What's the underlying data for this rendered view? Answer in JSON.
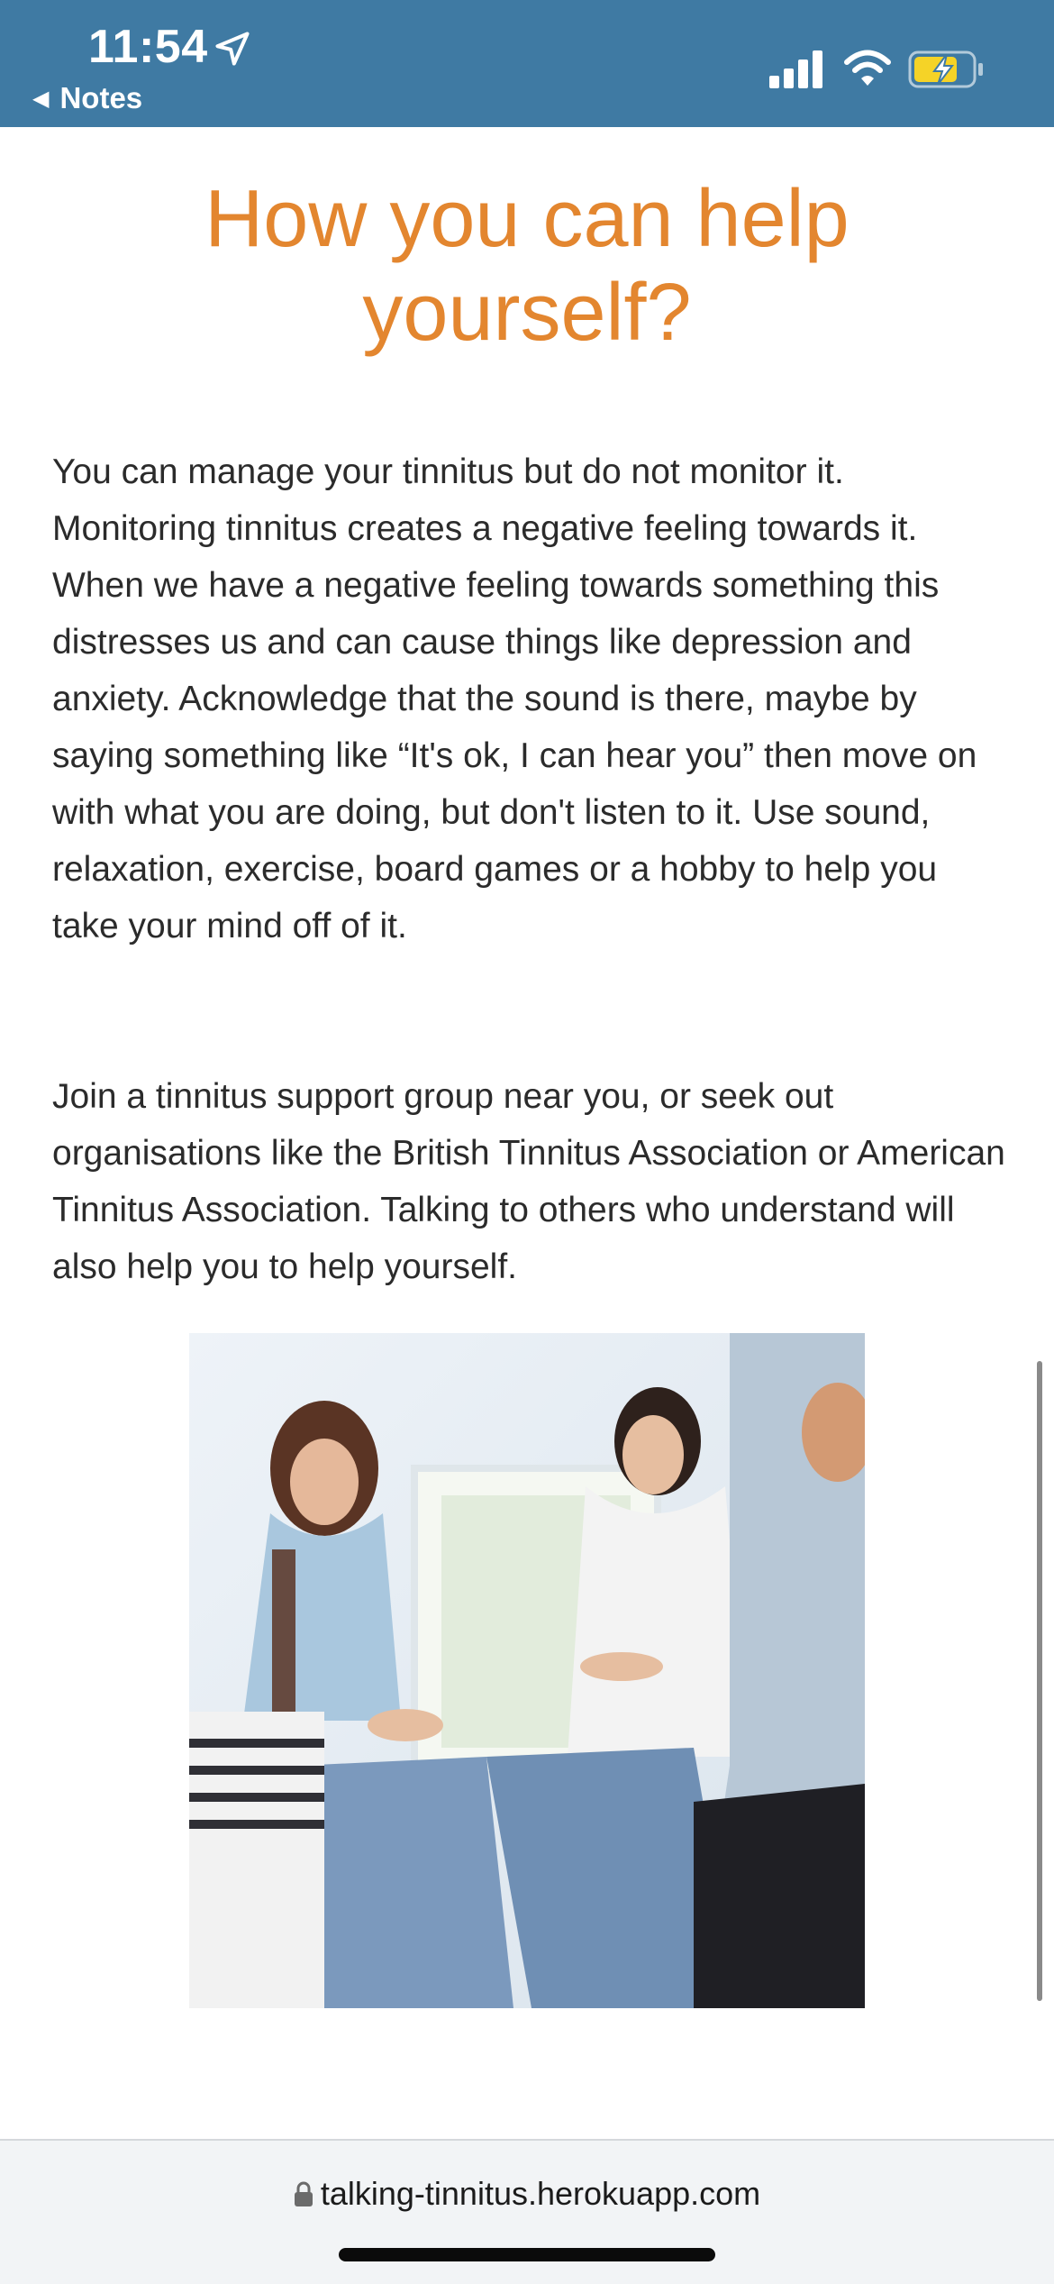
{
  "status_bar": {
    "time": "11:54",
    "back_label": "Notes",
    "background_color": "#3f7aa3",
    "icons": [
      "location-arrow-icon",
      "cellular-signal-icon",
      "wifi-icon",
      "battery-charging-icon"
    ]
  },
  "article": {
    "title": "How you can help yourself?",
    "title_color": "#e3862f",
    "paragraph_1": "You can manage your tinnitus but do not monitor it. Monitoring tinnitus creates a negative feeling towards it. When we have a negative feeling towards something this distresses us and can cause things like depression and anxiety. Acknowledge that the sound is there, maybe by saying something like “It's ok, I can hear you” then move on with what you are doing, but don't listen to it. Use sound, relaxation, exercise, board games or a hobby to help you take your mind off of it.",
    "paragraph_2": "Join a tinnitus support group near you, or seek out organisations like the British Tinnitus Association or American Tinnitus Association. Talking to others who understand will also help you to help yourself."
  },
  "browser": {
    "url": "talking-tinnitus.herokuapp.com"
  }
}
